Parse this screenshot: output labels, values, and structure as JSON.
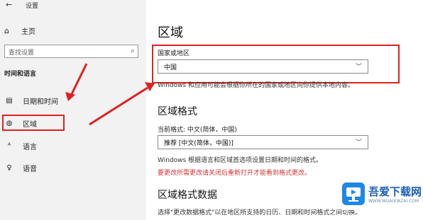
{
  "window": {
    "title": "设置"
  },
  "sidebar": {
    "home_label": "主页",
    "search_placeholder": "查找设置",
    "section_heading": "时间和语言",
    "items": [
      {
        "label": "日期和时间",
        "icon": "calendar-clock-icon"
      },
      {
        "label": "区域",
        "icon": "globe-icon"
      },
      {
        "label": "语言",
        "icon": "language-icon"
      },
      {
        "label": "语音",
        "icon": "microphone-icon"
      }
    ]
  },
  "main": {
    "title": "区域",
    "country_label": "国家或地区",
    "country_value": "中国",
    "country_desc": "Windows 和应用可能会根据你所在的国家或地区向你提供本地内容。",
    "format_heading": "区域格式",
    "current_format_label": "当前格式: 中文(简体，中国)",
    "format_value": "推荐 [中文(简体，中国)]",
    "format_desc": "Windows 根据语言和区域首选项设置日期和时间的格式。",
    "format_warning": "要更改所需更改请关闭后重新打开才能看到格式更改。",
    "format_data_heading": "区域格式数据",
    "format_data_desc": "选择\"更改数据格式\"以在地区所支持的日历、日期和时间格式之间切换。"
  },
  "watermark": {
    "brand": "吾爱下载网",
    "url": "WWW.WUAIXIAZAI.COM"
  },
  "colors": {
    "highlight": "#e02020",
    "sidebar_bg": "#f2f2f2",
    "warning": "#d13438",
    "brand": "#1a5fb4"
  }
}
